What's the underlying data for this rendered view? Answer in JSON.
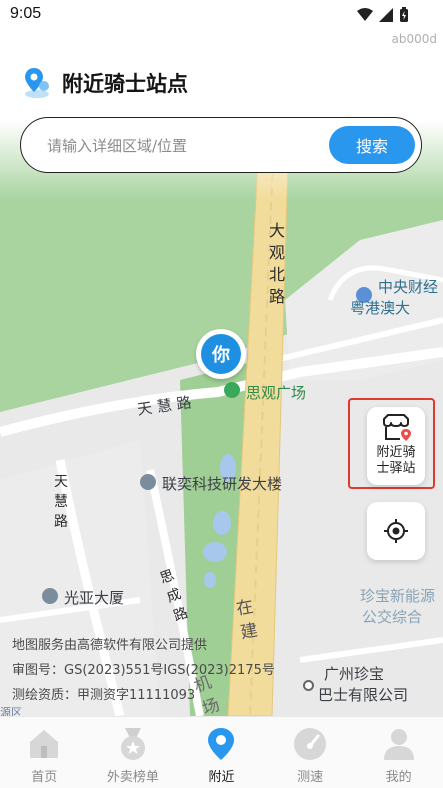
{
  "status_bar": {
    "time": "9:05",
    "tag": "ab000d"
  },
  "header": {
    "title": "附近骑士站点",
    "icon": "map-pin-location-icon"
  },
  "search": {
    "placeholder": "请输入详细区域/位置",
    "value": "",
    "button_label": "搜索"
  },
  "map": {
    "labels": {
      "road_daguan": "大观北路",
      "road_tianhui_horizontal": "天 慧 路",
      "road_tianhui_vertical": "天慧路",
      "road_sicheng": "思成路",
      "road_zaijian": "在建",
      "road_fragment": "机场",
      "poi_sikuan": "思观广场",
      "poi_lianyi": "联奕科技研发大楼",
      "poi_guangya": "光亚大厦",
      "poi_zhongyang": "中央财经",
      "poi_yuegang": "粤港澳大",
      "poi_zhenbao_energy": "珍宝新能源",
      "poi_bus": "公交综合",
      "poi_guangzhou_zhenbao_1": "广州珍宝",
      "poi_guangzhou_zhenbao_2": "巴士有限公司",
      "poi_edge": "源区"
    },
    "you_marker": "你",
    "credits": [
      "地图服务由高德软件有限公司提供",
      "审图号：GS(2023)551号IGS(2023)2175号",
      "测绘资质：甲测资字11111093"
    ]
  },
  "floating": {
    "nearby_station_label": "附近骑士驿站",
    "locate_icon": "locate-crosshair-icon"
  },
  "bottom_nav": {
    "items": [
      {
        "label": "首页",
        "icon": "home-icon",
        "active": false
      },
      {
        "label": "外卖榜单",
        "icon": "medal-star-icon",
        "active": false
      },
      {
        "label": "附近",
        "icon": "location-pin-icon",
        "active": true
      },
      {
        "label": "测速",
        "icon": "speedometer-icon",
        "active": false
      },
      {
        "label": "我的",
        "icon": "user-icon",
        "active": false
      }
    ]
  },
  "colors": {
    "accent": "#2a97ef",
    "highlight": "#e0392f",
    "map_green": "#a8d6a0",
    "road_yellow": "#f2dc9b"
  }
}
